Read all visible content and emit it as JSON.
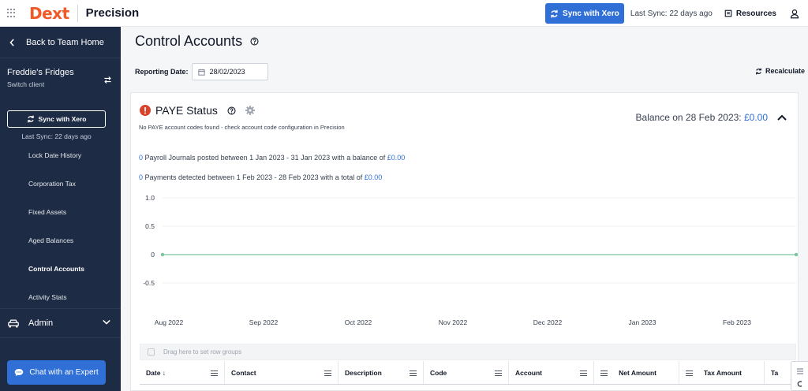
{
  "topbar": {
    "logo": "Dext",
    "product": "Precision",
    "sync_label": "Sync with Xero",
    "last_sync": "Last Sync: 22 days ago",
    "resources": "Resources"
  },
  "sidebar": {
    "back_label": "Back to Team Home",
    "client_name": "Freddie's Fridges",
    "switch_client": "Switch client",
    "sync_label": "Sync with Xero",
    "last_sync": "Last Sync: 22 days ago",
    "nav_items": [
      {
        "label": "Lock Date History",
        "active": false
      },
      {
        "label": "Corporation Tax",
        "active": false
      },
      {
        "label": "Fixed Assets",
        "active": false
      },
      {
        "label": "Aged Balances",
        "active": false
      },
      {
        "label": "Control Accounts",
        "active": true
      },
      {
        "label": "Activity Stats",
        "active": false
      }
    ],
    "admin_label": "Admin",
    "chat_label": "Chat with an Expert"
  },
  "main": {
    "title": "Control Accounts",
    "reporting_label": "Reporting Date:",
    "reporting_date": "28/02/2023",
    "recalculate": "Recalculate"
  },
  "card": {
    "title": "PAYE Status",
    "subtitle": "No PAYE account codes found - check account code configuration in Precision",
    "balance_label": "Balance on 28 Feb 2023:",
    "balance_value": "£0.00",
    "line1": {
      "count": "0",
      "text": "Payroll Journals posted between 1 Jan 2023 - 31 Jan 2023 with a balance of",
      "amount": "£0.00"
    },
    "line2": {
      "count": "0",
      "text": "Payments detected between 1 Feb 2023 - 28 Feb 2023 with a total of",
      "amount": "£0.00"
    },
    "group_hint": "Drag here to set row groups",
    "columns": [
      {
        "label": "Date ↓",
        "align": "left"
      },
      {
        "label": "Contact",
        "align": "left"
      },
      {
        "label": "Description",
        "align": "left"
      },
      {
        "label": "Code",
        "align": "left"
      },
      {
        "label": "Account",
        "align": "left"
      },
      {
        "label": "Net Amount",
        "align": "right"
      },
      {
        "label": "Tax Amount",
        "align": "right"
      },
      {
        "label": "Ta",
        "align": "left"
      }
    ]
  },
  "chart_data": {
    "type": "line",
    "categories": [
      "Aug 2022",
      "Sep 2022",
      "Oct 2022",
      "Nov 2022",
      "Dec 2022",
      "Jan 2023",
      "Feb 2023"
    ],
    "y_ticks": [
      "1.0",
      "0.5",
      "0",
      "-0.5"
    ],
    "ylim": [
      -1,
      1
    ],
    "series": [
      {
        "values": [
          0,
          0
        ],
        "color": "#7cc4a0"
      }
    ],
    "title": "",
    "xlabel": "",
    "ylabel": "",
    "grid": true,
    "accent": "#2f6fd6"
  }
}
